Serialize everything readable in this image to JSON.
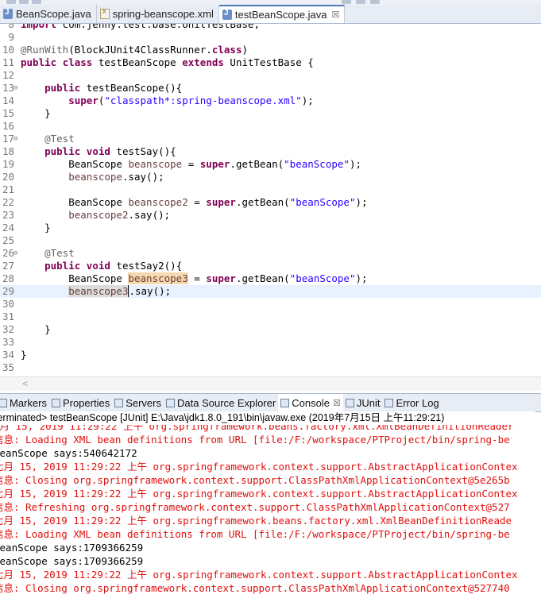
{
  "editor_tabs": [
    {
      "label": "BeanScope.java",
      "icon": "java-file-icon",
      "active": false,
      "closable": false
    },
    {
      "label": "spring-beanscope.xml",
      "icon": "xml-file-icon",
      "active": false,
      "closable": false
    },
    {
      "label": "testBeanScope.java",
      "icon": "java-file-icon",
      "active": true,
      "closable": true,
      "close": "☒"
    }
  ],
  "code_lines": [
    {
      "n": "8",
      "text": "import com.jenny.test.base.UnitTestBase;"
    },
    {
      "n": "9",
      "text": ""
    },
    {
      "n": "10",
      "text": "@RunWith(BlockJUnit4ClassRunner.class)"
    },
    {
      "n": "11",
      "text": "public class testBeanScope extends UnitTestBase {"
    },
    {
      "n": "12",
      "text": ""
    },
    {
      "n": "13",
      "text": "    public testBeanScope(){",
      "fold": true
    },
    {
      "n": "14",
      "text": "        super(\"classpath*:spring-beanscope.xml\");"
    },
    {
      "n": "15",
      "text": "    }"
    },
    {
      "n": "16",
      "text": ""
    },
    {
      "n": "17",
      "text": "    @Test",
      "fold": true
    },
    {
      "n": "18",
      "text": "    public void testSay(){"
    },
    {
      "n": "19",
      "text": "        BeanScope beanscope = super.getBean(\"beanScope\");"
    },
    {
      "n": "20",
      "text": "        beanscope.say();"
    },
    {
      "n": "21",
      "text": ""
    },
    {
      "n": "22",
      "text": "        BeanScope beanscope2 = super.getBean(\"beanScope\");"
    },
    {
      "n": "23",
      "text": "        beanscope2.say();"
    },
    {
      "n": "24",
      "text": "    }"
    },
    {
      "n": "25",
      "text": ""
    },
    {
      "n": "26",
      "text": "    @Test",
      "fold": true
    },
    {
      "n": "27",
      "text": "    public void testSay2(){"
    },
    {
      "n": "28",
      "text": "        BeanScope beanscope3 = super.getBean(\"beanScope\");"
    },
    {
      "n": "29",
      "text": "        beanscope3.say();",
      "current": true
    },
    {
      "n": "30",
      "text": ""
    },
    {
      "n": "31",
      "text": ""
    },
    {
      "n": "32",
      "text": "    }"
    },
    {
      "n": "33",
      "text": ""
    },
    {
      "n": "34",
      "text": "}"
    },
    {
      "n": "35",
      "text": ""
    }
  ],
  "scroll_arrow": "<",
  "view_tabs": [
    {
      "label": "Markers",
      "icon": "markers-icon"
    },
    {
      "label": "Properties",
      "icon": "properties-icon"
    },
    {
      "label": "Servers",
      "icon": "servers-icon"
    },
    {
      "label": "Data Source Explorer",
      "icon": "data-source-icon"
    },
    {
      "label": "Console",
      "icon": "console-icon",
      "active": true,
      "close": "☒"
    },
    {
      "label": "JUnit",
      "icon": "junit-icon"
    },
    {
      "label": "Error Log",
      "icon": "error-log-icon"
    }
  ],
  "console_header": "terminated> testBeanScope [JUnit] E:\\Java\\jdk1.8.0_191\\bin\\javaw.exe (2019年7月15日 上午11:29:21)",
  "console_lines": [
    {
      "kind": "err",
      "text": "7月 15, 2019 11:29:22 上午 org.springframework.beans.factory.xml.XmlBeanDefinitionReader"
    },
    {
      "kind": "err",
      "text": "信息: Loading XML bean definitions from URL [file:/F:/workspace/PTProject/bin/spring-be"
    },
    {
      "kind": "out",
      "text": "BeanScope says:540642172"
    },
    {
      "kind": "err",
      "text": "七月 15, 2019 11:29:22 上午 org.springframework.context.support.AbstractApplicationContex"
    },
    {
      "kind": "err",
      "text": "信息: Closing org.springframework.context.support.ClassPathXmlApplicationContext@5e265b"
    },
    {
      "kind": "err",
      "text": "七月 15, 2019 11:29:22 上午 org.springframework.context.support.AbstractApplicationContex"
    },
    {
      "kind": "err",
      "text": "信息: Refreshing org.springframework.context.support.ClassPathXmlApplicationContext@527"
    },
    {
      "kind": "err",
      "text": "七月 15, 2019 11:29:22 上午 org.springframework.beans.factory.xml.XmlBeanDefinitionReade"
    },
    {
      "kind": "err",
      "text": "信息: Loading XML bean definitions from URL [file:/F:/workspace/PTProject/bin/spring-be"
    },
    {
      "kind": "out",
      "text": "BeanScope says:1709366259"
    },
    {
      "kind": "out",
      "text": "BeanScope says:1709366259"
    },
    {
      "kind": "err",
      "text": "七月 15, 2019 11:29:22 上午 org.springframework.context.support.AbstractApplicationContex"
    },
    {
      "kind": "err",
      "text": "信息: Closing org.springframework.context.support.ClassPathXmlApplicationContext@527740"
    }
  ]
}
